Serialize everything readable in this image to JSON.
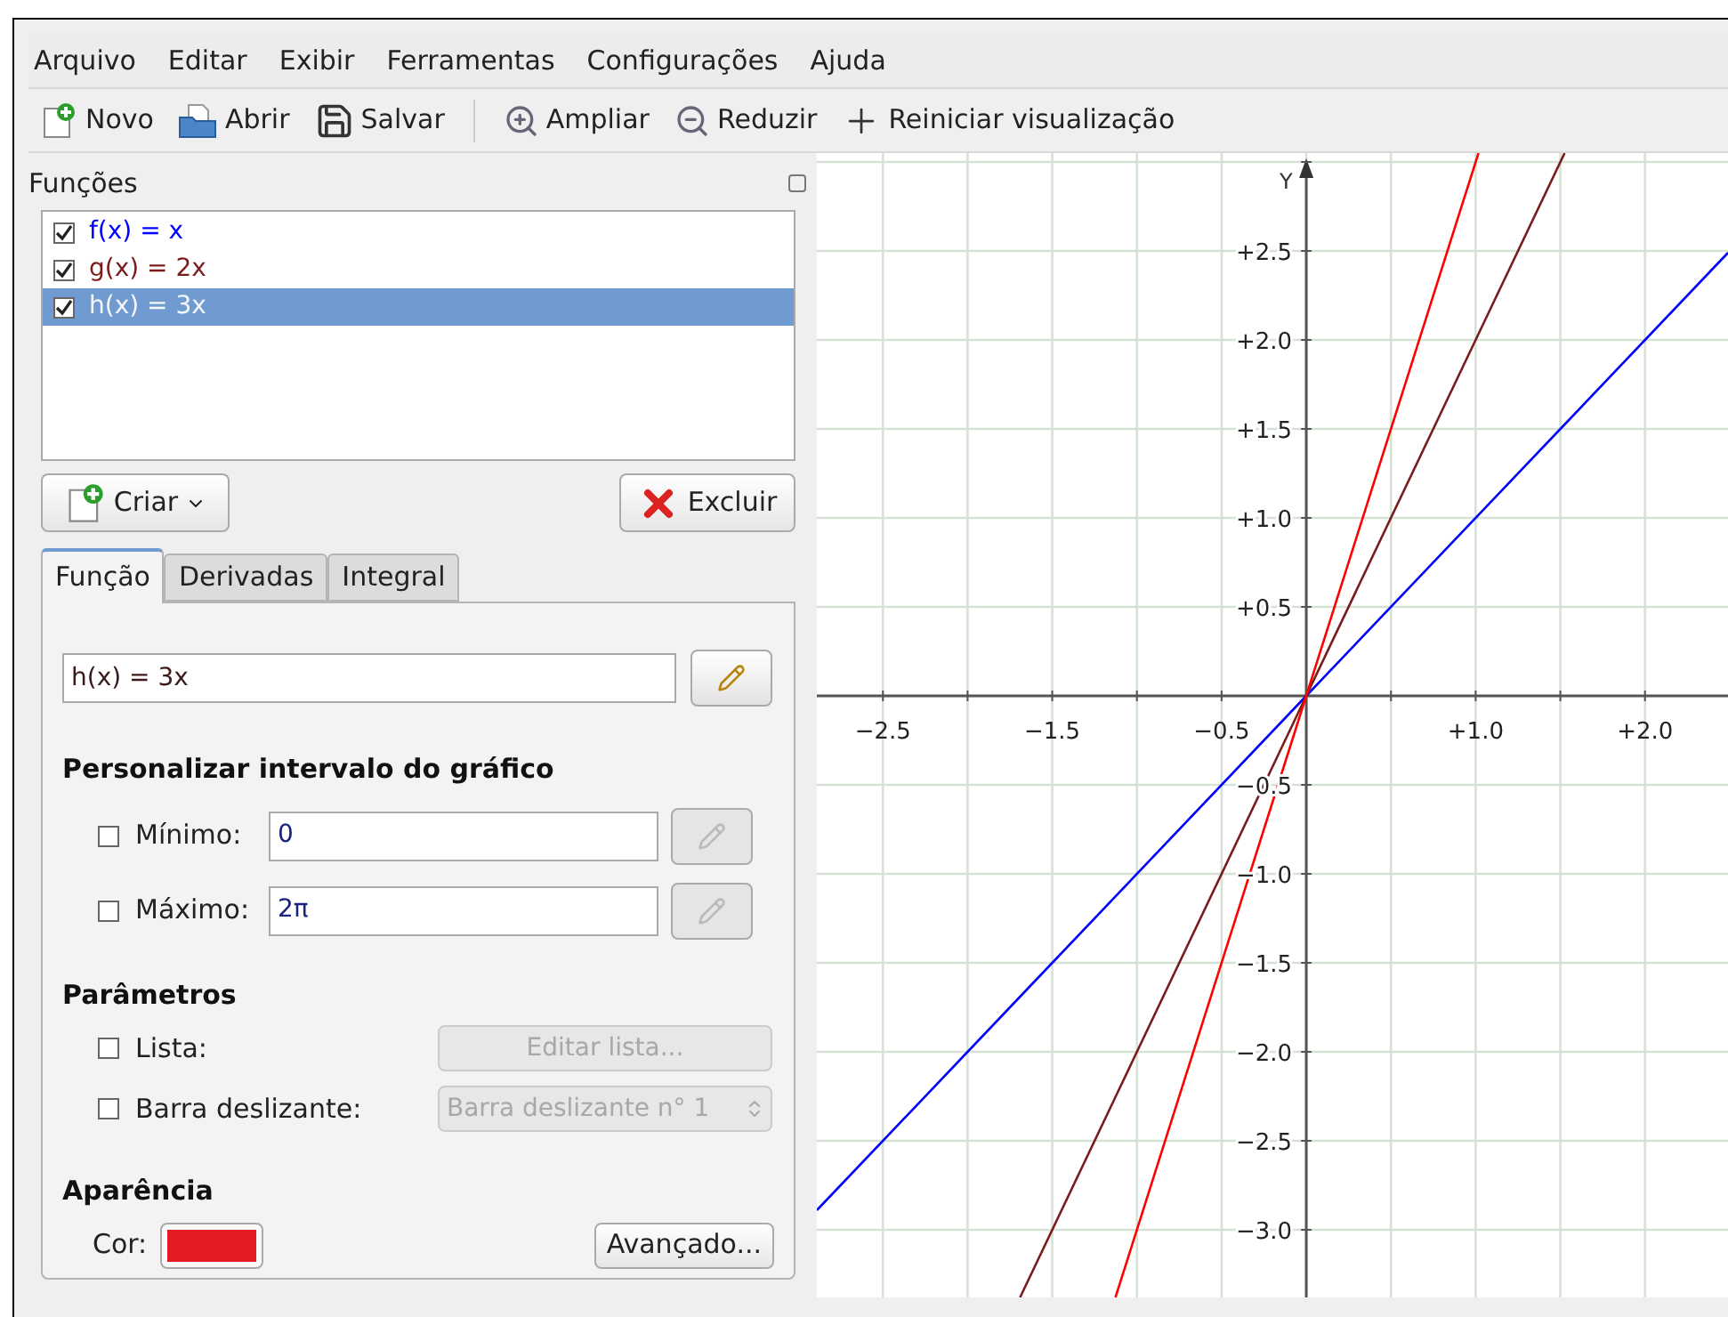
{
  "menu": [
    "Arquivo",
    "Editar",
    "Exibir",
    "Ferramentas",
    "Configurações",
    "Ajuda"
  ],
  "toolbar": {
    "file": [
      {
        "kind": "new",
        "label": "Novo"
      },
      {
        "kind": "open",
        "label": "Abrir"
      },
      {
        "kind": "save",
        "label": "Salvar"
      }
    ],
    "view": [
      {
        "kind": "zoom_in",
        "label": "Ampliar"
      },
      {
        "kind": "zoom_out",
        "label": "Reduzir"
      },
      {
        "kind": "reset",
        "label": "Reiniciar visualização"
      }
    ]
  },
  "panel": {
    "title": "Funções",
    "functions": [
      {
        "label": "f(x) = x",
        "checked": true,
        "selected": false
      },
      {
        "label": "g(x) = 2x",
        "checked": true,
        "selected": false
      },
      {
        "label": "h(x) = 3x",
        "checked": true,
        "selected": true
      }
    ],
    "create_button": "Criar",
    "delete_button": "Excluir",
    "tabs": [
      {
        "label": "Função",
        "selected": true
      },
      {
        "label": "Derivadas",
        "selected": false
      },
      {
        "label": "Integral",
        "selected": false
      }
    ],
    "equation": "h(x) = 3x",
    "interval_title": "Personalizar intervalo do gráfico",
    "interval": [
      {
        "label": "Mínimo:",
        "checked": false,
        "value": "0",
        "edit_disabled": true
      },
      {
        "label": "Máximo:",
        "checked": false,
        "value": "2π",
        "edit_disabled": true
      }
    ],
    "parameters_title": "Parâmetros",
    "list_option": {
      "label": "Lista:",
      "checked": false,
      "button": "Editar lista...",
      "disabled": true
    },
    "slider_option": {
      "label": "Barra deslizante:",
      "checked": false,
      "value": "Barra deslizante n° 1",
      "disabled": true
    },
    "appearance_title": "Aparência",
    "color_label": "Cor:",
    "color": "#e31b23",
    "advanced_button": "Avançado..."
  },
  "plot": {
    "chart_data": {
      "type": "line",
      "x": [
        -2.89,
        -1.69,
        -1.127,
        0,
        1.017,
        1.525,
        2.49
      ],
      "series": [
        {
          "color": "#0000ff",
          "values": [
            -2.89,
            -1.69,
            -1.127,
            0,
            1.017,
            1.525,
            2.49
          ]
        },
        {
          "color": "#7a1c1c",
          "values": [
            null,
            -3.38,
            -2.254,
            0,
            2.034,
            3.05,
            null
          ]
        },
        {
          "color": "#ff0000",
          "values": [
            null,
            null,
            -3.38,
            0,
            3.05,
            null,
            null
          ]
        }
      ],
      "ylabel": "Y",
      "grid": true,
      "xlim": [
        -2.89,
        2.49
      ],
      "ylim": [
        -3.38,
        3.05
      ],
      "xticks": [
        {
          "value": -2.5,
          "label": "−2.5"
        },
        {
          "value": -1.5,
          "label": "−1.5"
        },
        {
          "value": -0.5,
          "label": "−0.5"
        },
        {
          "value": 1,
          "label": "+1.0"
        },
        {
          "value": 2,
          "label": "+2.0"
        }
      ],
      "yticks": [
        {
          "value": 2.5,
          "label": "+2.5"
        },
        {
          "value": 2,
          "label": "+2.0"
        },
        {
          "value": 1.5,
          "label": "+1.5"
        },
        {
          "value": 1,
          "label": "+1.0"
        },
        {
          "value": 0.5,
          "label": "+0.5"
        },
        {
          "value": -0.5,
          "label": "−0.5"
        },
        {
          "value": -1,
          "label": "−1.0"
        },
        {
          "value": -1.5,
          "label": "−1.5"
        },
        {
          "value": -2,
          "label": "−2.0"
        },
        {
          "value": -2.5,
          "label": "−2.5"
        },
        {
          "value": -3,
          "label": "−3.0"
        }
      ]
    }
  }
}
